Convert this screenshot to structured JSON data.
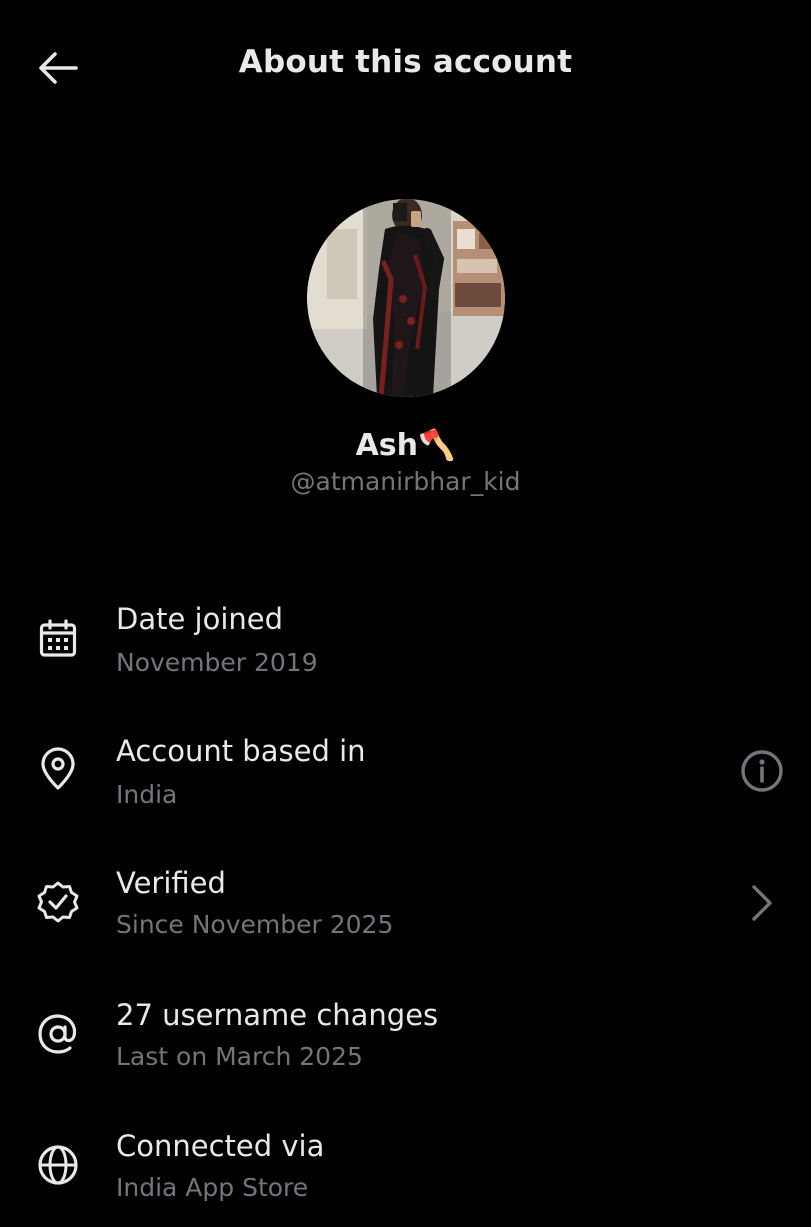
{
  "header": {
    "title": "About this account",
    "back_icon": "arrow-left-icon"
  },
  "profile": {
    "display_name": "Ash🪓",
    "handle": "@atmanirbhar_kid",
    "avatar": "profile-photo"
  },
  "details": [
    {
      "icon": "calendar-icon",
      "title": "Date joined",
      "subtitle": "November 2019"
    },
    {
      "icon": "location-pin-icon",
      "title": "Account based in",
      "subtitle": "India",
      "action_icon": "info-icon"
    },
    {
      "icon": "verified-badge-icon",
      "title": "Verified",
      "subtitle": "Since November 2025",
      "action_icon": "chevron-right-icon"
    },
    {
      "icon": "at-sign-icon",
      "title": "27 username changes",
      "subtitle": "Last on March 2025"
    },
    {
      "icon": "globe-icon",
      "title": "Connected via",
      "subtitle": "India App Store"
    }
  ],
  "colors": {
    "background": "#000000",
    "primary_text": "#e7e9ea",
    "secondary_text": "#71767b"
  }
}
